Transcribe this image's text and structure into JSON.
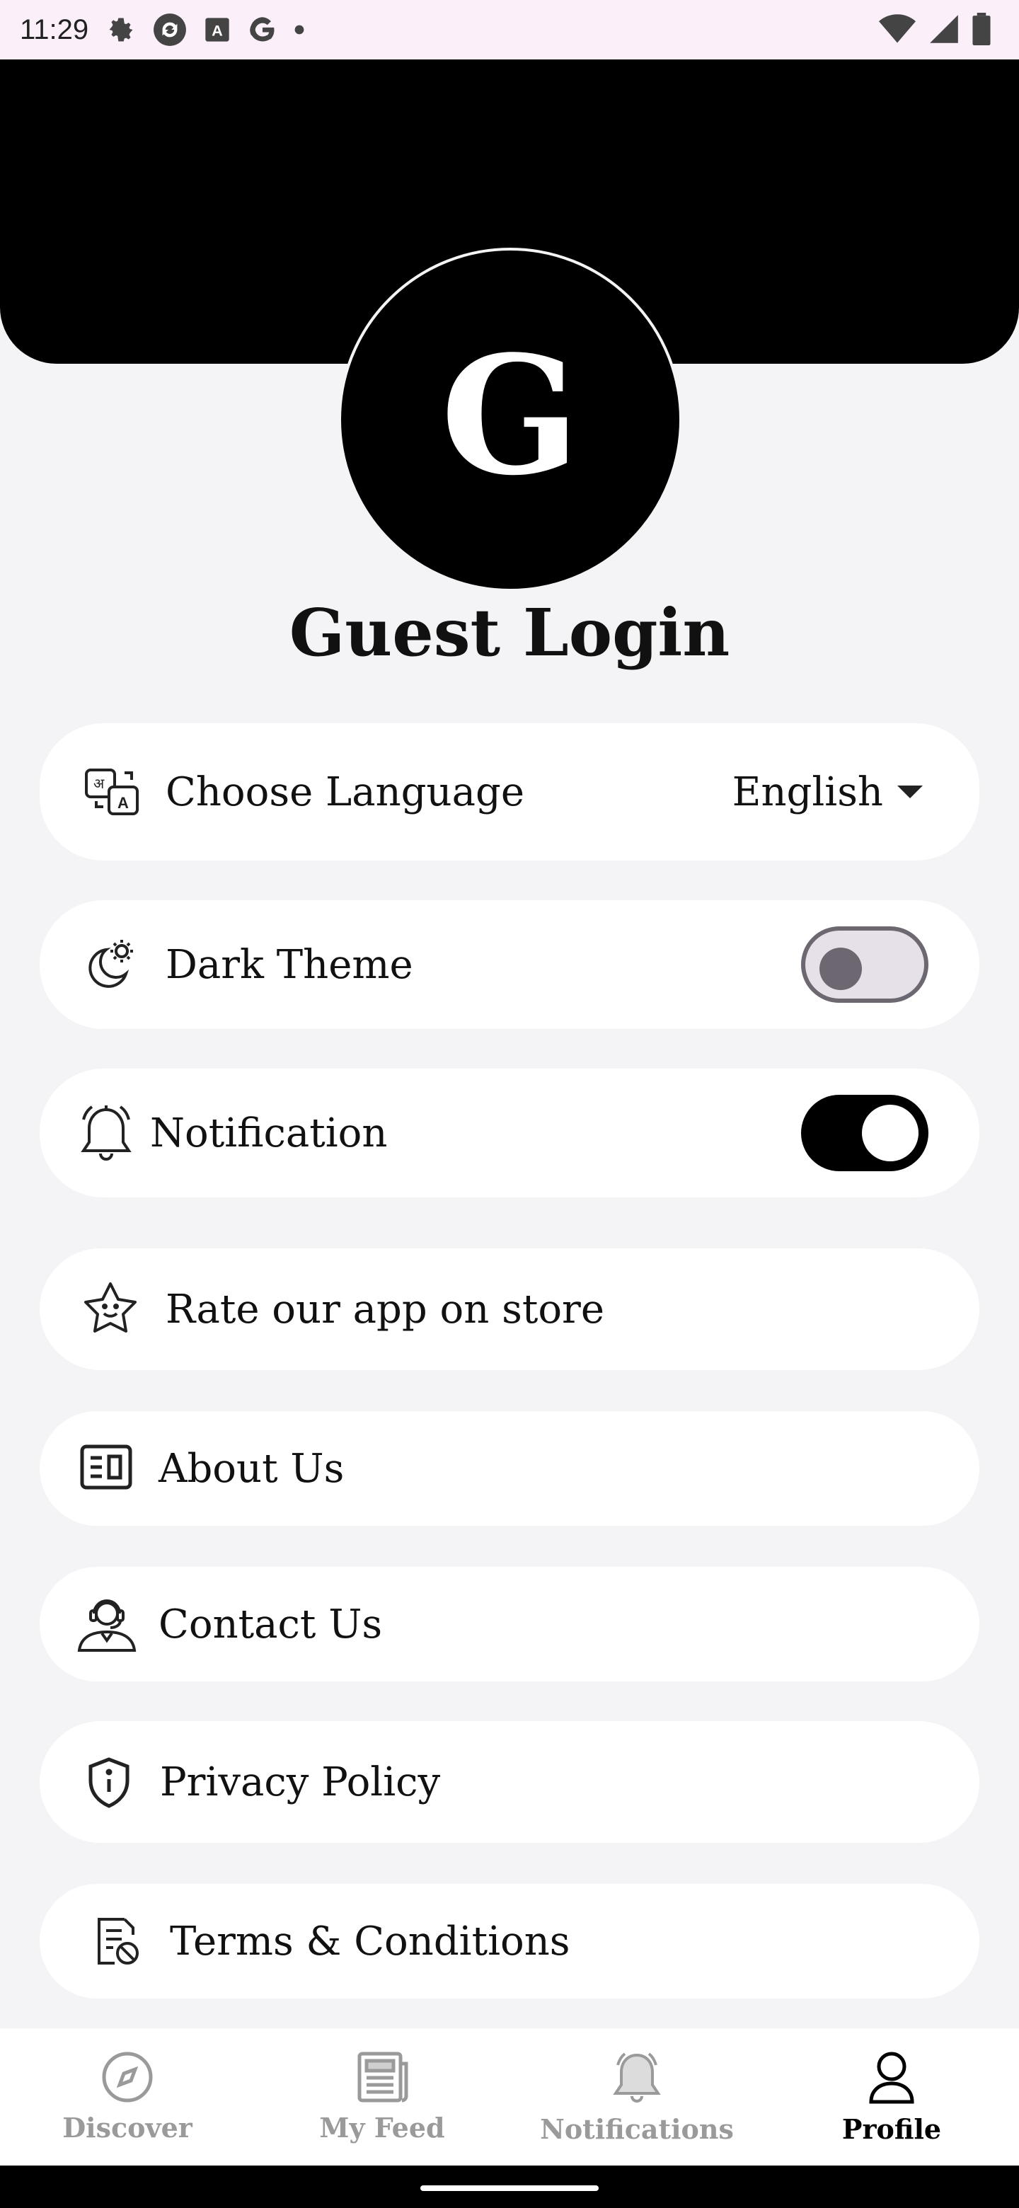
{
  "status": {
    "time": "11:29"
  },
  "profile": {
    "avatar_letter": "G",
    "title": "Guest Login"
  },
  "settings": {
    "language": {
      "label": "Choose Language",
      "value": "English"
    },
    "dark_theme": {
      "label": "Dark Theme",
      "enabled": false
    },
    "notification": {
      "label": "Notification",
      "enabled": true
    },
    "rate": {
      "label": "Rate our app on store"
    },
    "about": {
      "label": "About Us"
    },
    "contact": {
      "label": "Contact Us"
    },
    "privacy": {
      "label": "Privacy Policy"
    },
    "terms": {
      "label": "Terms & Conditions"
    }
  },
  "nav": {
    "items": [
      {
        "label": "Discover",
        "icon": "compass-icon",
        "active": false
      },
      {
        "label": "My Feed",
        "icon": "newspaper-icon",
        "active": false
      },
      {
        "label": "Notifications",
        "icon": "bell-icon",
        "active": false
      },
      {
        "label": "Profile",
        "icon": "person-icon",
        "active": true
      }
    ]
  },
  "colors": {
    "accent": "#000000",
    "background": "#f4f4f6",
    "card": "#ffffff",
    "inactive_nav": "#9a9a9a"
  }
}
